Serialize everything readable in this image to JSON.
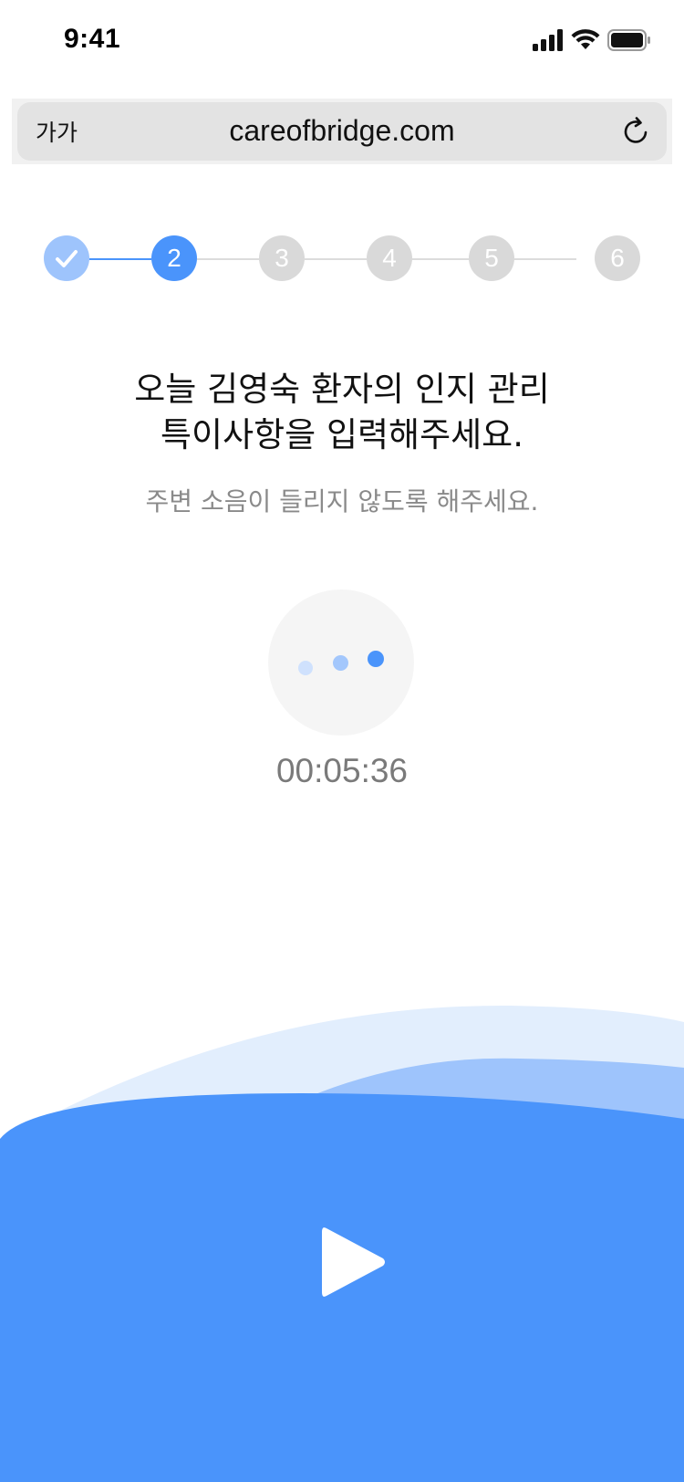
{
  "status_bar": {
    "time": "9:41",
    "icons": [
      "cellular-signal-icon",
      "wifi-icon",
      "battery-icon"
    ]
  },
  "browser": {
    "text_size_label": "가가",
    "url": "careofbridge.com",
    "reload_icon": "reload-icon"
  },
  "stepper": {
    "steps": [
      {
        "label": "",
        "state": "done"
      },
      {
        "label": "2",
        "state": "current"
      },
      {
        "label": "3",
        "state": "upcoming"
      },
      {
        "label": "4",
        "state": "upcoming"
      },
      {
        "label": "5",
        "state": "upcoming"
      },
      {
        "label": "6",
        "state": "upcoming"
      }
    ],
    "current_step": 2,
    "total_steps": 6
  },
  "main": {
    "title_line1": "오늘 김영숙 환자의 인지 관리",
    "title_line2": "특이사항을 입력해주세요.",
    "subtitle": "주변 소음이 들리지 않도록 해주세요.",
    "timer": "00:05:36"
  },
  "controls": {
    "play_icon": "play-icon"
  },
  "colors": {
    "accent": "#4a94fb",
    "accent_light": "#9ec4fc",
    "accent_pale": "#e2eefd",
    "step_inactive": "#d9d9d9"
  }
}
